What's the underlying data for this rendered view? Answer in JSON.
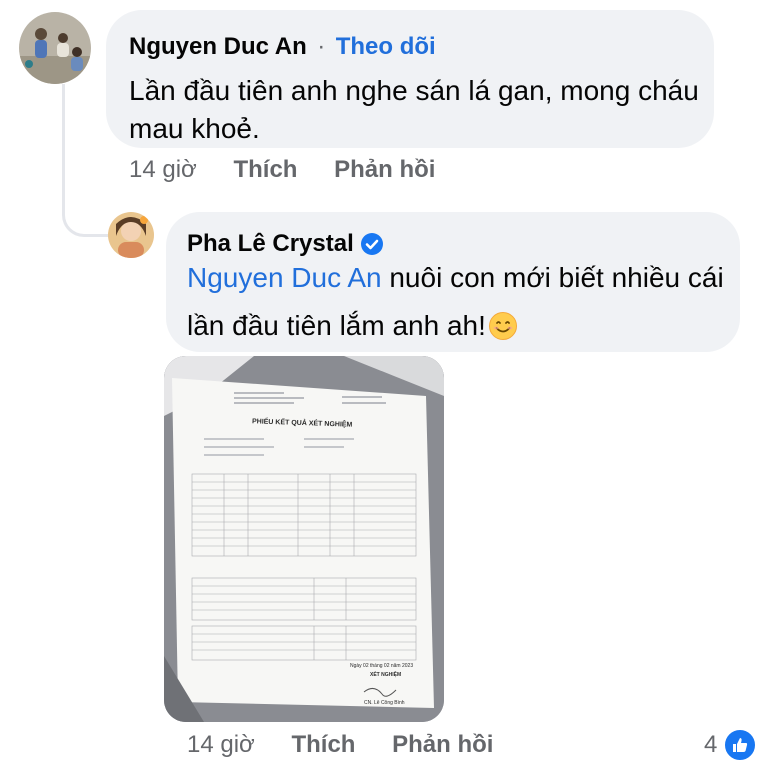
{
  "comment": {
    "author": "Nguyen Duc An",
    "separator": "·",
    "follow_label": "Theo dõi",
    "text_line1": "Lần đầu tiên anh nghe sán lá gan, mong cháu",
    "text_line2": "mau khoẻ.",
    "time": "14 giờ",
    "like_label": "Thích",
    "reply_label": "Phản hồi",
    "avatar_icon": "children-photo-avatar"
  },
  "reply": {
    "author": "Pha Lê Crystal",
    "verified_icon": "verified-badge-icon",
    "mention": "Nguyen Duc An",
    "text_line1_rest": " nuôi con mới biết nhiều cái",
    "text_line2": "lần đầu tiên lắm anh ah!",
    "emoji": "smiling-face-emoji",
    "time": "14 giờ",
    "like_label": "Thích",
    "reply_label": "Phản hồi",
    "reaction_count": "4",
    "reaction_icon": "like-icon",
    "avatar_icon": "woman-photo-avatar",
    "attachment": {
      "title": "PHIẾU KẾT QUẢ XÉT NGHIỆM",
      "footer_date": "Ngày 02 tháng 02 năm 2023",
      "footer_dept": "XÉT NGHIỆM",
      "footer_sign": "CN. Lê Công Bình"
    }
  },
  "colors": {
    "link_blue": "#216fdb",
    "meta_gray": "#65676b",
    "bubble_bg": "#f0f2f5",
    "badge_blue": "#1877f2"
  }
}
